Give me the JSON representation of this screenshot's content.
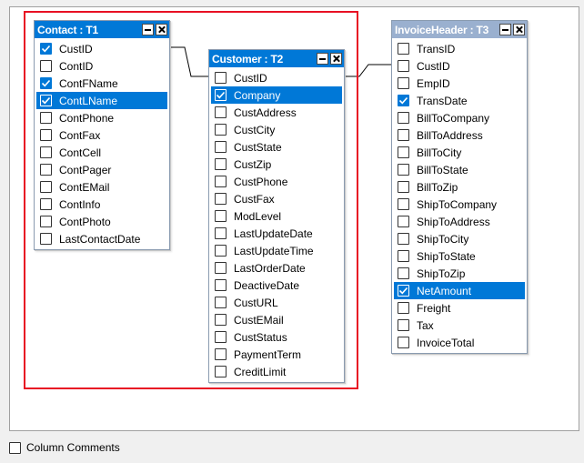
{
  "tables": [
    {
      "id": "t1",
      "title": "Contact : T1",
      "active": true,
      "columns": [
        {
          "name": "CustID",
          "checked": true,
          "selected": false
        },
        {
          "name": "ContID",
          "checked": false,
          "selected": false
        },
        {
          "name": "ContFName",
          "checked": true,
          "selected": false
        },
        {
          "name": "ContLName",
          "checked": true,
          "selected": true
        },
        {
          "name": "ContPhone",
          "checked": false,
          "selected": false
        },
        {
          "name": "ContFax",
          "checked": false,
          "selected": false
        },
        {
          "name": "ContCell",
          "checked": false,
          "selected": false
        },
        {
          "name": "ContPager",
          "checked": false,
          "selected": false
        },
        {
          "name": "ContEMail",
          "checked": false,
          "selected": false
        },
        {
          "name": "ContInfo",
          "checked": false,
          "selected": false
        },
        {
          "name": "ContPhoto",
          "checked": false,
          "selected": false
        },
        {
          "name": "LastContactDate",
          "checked": false,
          "selected": false
        }
      ]
    },
    {
      "id": "t2",
      "title": "Customer : T2",
      "active": true,
      "columns": [
        {
          "name": "CustID",
          "checked": false,
          "selected": false
        },
        {
          "name": "Company",
          "checked": true,
          "selected": true
        },
        {
          "name": "CustAddress",
          "checked": false,
          "selected": false
        },
        {
          "name": "CustCity",
          "checked": false,
          "selected": false
        },
        {
          "name": "CustState",
          "checked": false,
          "selected": false
        },
        {
          "name": "CustZip",
          "checked": false,
          "selected": false
        },
        {
          "name": "CustPhone",
          "checked": false,
          "selected": false
        },
        {
          "name": "CustFax",
          "checked": false,
          "selected": false
        },
        {
          "name": "ModLevel",
          "checked": false,
          "selected": false
        },
        {
          "name": "LastUpdateDate",
          "checked": false,
          "selected": false
        },
        {
          "name": "LastUpdateTime",
          "checked": false,
          "selected": false
        },
        {
          "name": "LastOrderDate",
          "checked": false,
          "selected": false
        },
        {
          "name": "DeactiveDate",
          "checked": false,
          "selected": false
        },
        {
          "name": "CustURL",
          "checked": false,
          "selected": false
        },
        {
          "name": "CustEMail",
          "checked": false,
          "selected": false
        },
        {
          "name": "CustStatus",
          "checked": false,
          "selected": false
        },
        {
          "name": "PaymentTerm",
          "checked": false,
          "selected": false
        },
        {
          "name": "CreditLimit",
          "checked": false,
          "selected": false
        }
      ]
    },
    {
      "id": "t3",
      "title": "InvoiceHeader : T3",
      "active": false,
      "columns": [
        {
          "name": "TransID",
          "checked": false,
          "selected": false
        },
        {
          "name": "CustID",
          "checked": false,
          "selected": false
        },
        {
          "name": "EmpID",
          "checked": false,
          "selected": false
        },
        {
          "name": "TransDate",
          "checked": true,
          "selected": false
        },
        {
          "name": "BillToCompany",
          "checked": false,
          "selected": false
        },
        {
          "name": "BillToAddress",
          "checked": false,
          "selected": false
        },
        {
          "name": "BillToCity",
          "checked": false,
          "selected": false
        },
        {
          "name": "BillToState",
          "checked": false,
          "selected": false
        },
        {
          "name": "BillToZip",
          "checked": false,
          "selected": false
        },
        {
          "name": "ShipToCompany",
          "checked": false,
          "selected": false
        },
        {
          "name": "ShipToAddress",
          "checked": false,
          "selected": false
        },
        {
          "name": "ShipToCity",
          "checked": false,
          "selected": false
        },
        {
          "name": "ShipToState",
          "checked": false,
          "selected": false
        },
        {
          "name": "ShipToZip",
          "checked": false,
          "selected": false
        },
        {
          "name": "NetAmount",
          "checked": true,
          "selected": true
        },
        {
          "name": "Freight",
          "checked": false,
          "selected": false
        },
        {
          "name": "Tax",
          "checked": false,
          "selected": false
        },
        {
          "name": "InvoiceTotal",
          "checked": false,
          "selected": false
        }
      ]
    }
  ],
  "footer": {
    "column_comments_label": "Column Comments",
    "column_comments_checked": false
  },
  "icons": {
    "minimize": "minimize-icon",
    "close": "close-icon",
    "checkmark": "checkmark-icon"
  },
  "colors": {
    "selection": "#0078d7",
    "inactive_header": "#9ab0cf",
    "highlight_box": "#e81123"
  }
}
